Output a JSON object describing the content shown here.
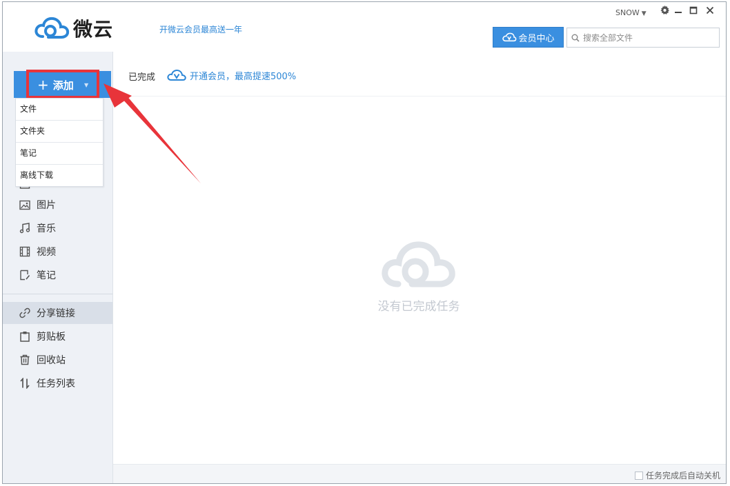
{
  "app": {
    "name": "微云",
    "promo": "开微云会员最高送一年",
    "user": "SNOW",
    "member_center": "会员中心",
    "search_placeholder": "搜索全部文件"
  },
  "sidebar": {
    "add_label": "添加",
    "add_menu": [
      "文件",
      "文件夹",
      "笔记",
      "离线下载"
    ],
    "items": [
      {
        "label": "图片",
        "icon": "image-icon"
      },
      {
        "label": "音乐",
        "icon": "music-icon"
      },
      {
        "label": "视频",
        "icon": "video-icon"
      },
      {
        "label": "笔记",
        "icon": "note-icon"
      }
    ],
    "items2": [
      {
        "label": "分享链接",
        "icon": "link-icon",
        "active": true
      },
      {
        "label": "剪贴板",
        "icon": "clipboard-icon"
      },
      {
        "label": "回收站",
        "icon": "trash-icon"
      },
      {
        "label": "任务列表",
        "icon": "transfer-icon"
      }
    ]
  },
  "main": {
    "tab_label": "已完成",
    "vip_promo": "开通会员，最高提速500%",
    "empty_text": "没有已完成任务",
    "auto_shutdown": "任务完成后自动关机"
  },
  "colors": {
    "accent": "#3a8fe0",
    "highlight": "#e8343a",
    "sidebar_bg": "#eef1f6"
  }
}
